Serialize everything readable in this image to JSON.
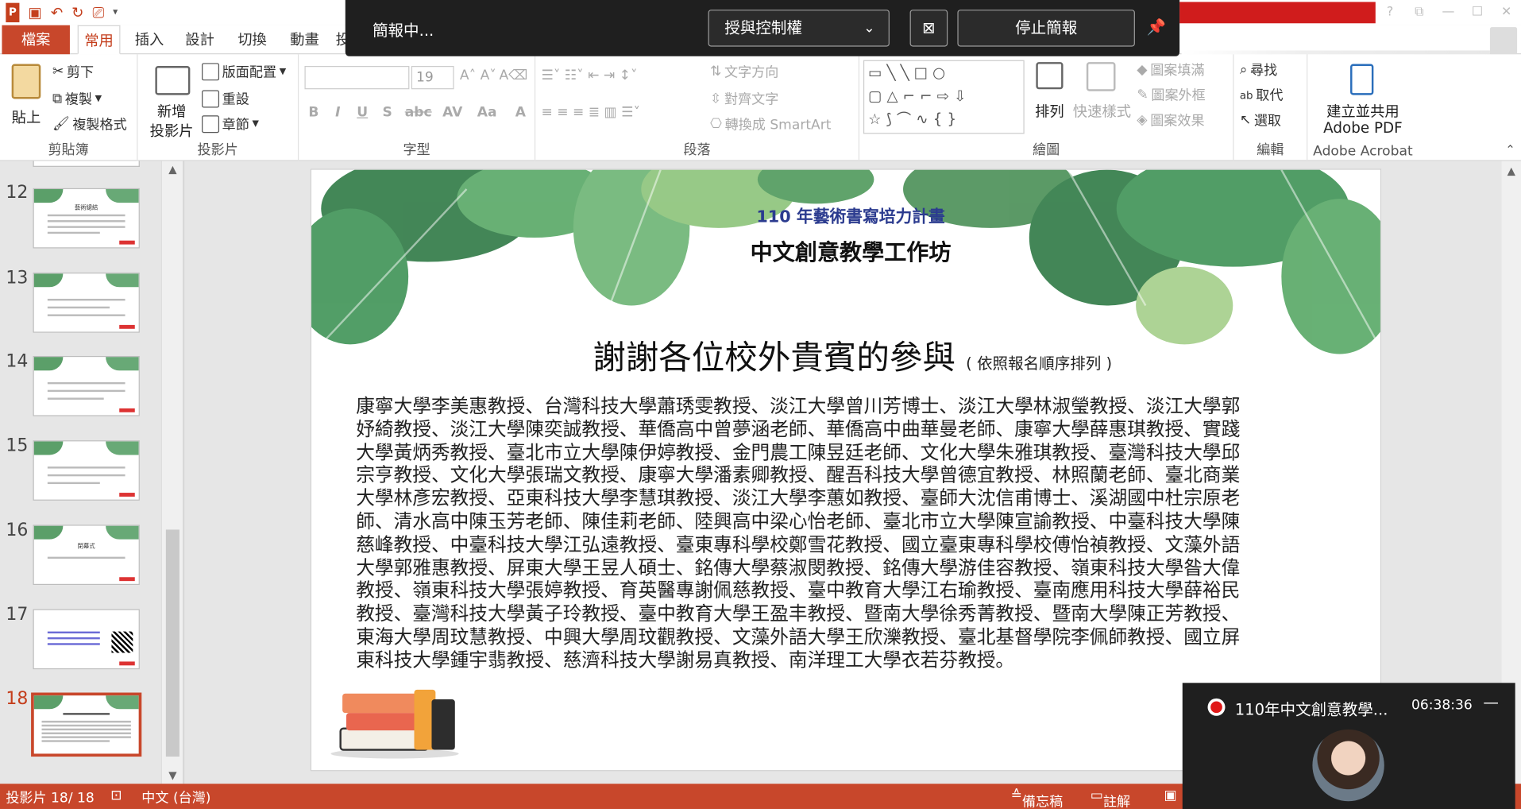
{
  "window": {
    "title_bar_buttons": [
      "?",
      "⧉",
      "—",
      "☐",
      "✕"
    ]
  },
  "tabs": [
    "檔案",
    "常用",
    "插入",
    "設計",
    "切換",
    "動畫",
    "投"
  ],
  "ribbon": {
    "clipboard": {
      "label": "剪貼簿",
      "paste": "貼上",
      "cut": "剪下",
      "copy": "複製",
      "format_painter": "複製格式"
    },
    "slides": {
      "label": "投影片",
      "new_slide_1": "新增",
      "new_slide_2": "投影片",
      "layout": "版面配置",
      "reset": "重設",
      "section": "章節"
    },
    "font": {
      "label": "字型",
      "size": "19"
    },
    "paragraph": {
      "label": "段落",
      "text_direction": "文字方向",
      "align_text": "對齊文字",
      "smartart": "轉換成 SmartArt"
    },
    "drawing": {
      "label": "繪圖",
      "arrange": "排列",
      "quick_styles": "快速樣式",
      "shape_fill": "圖案填滿",
      "shape_outline": "圖案外框",
      "shape_effects": "圖案效果"
    },
    "editing": {
      "label": "編輯",
      "find": "尋找",
      "replace": "取代",
      "select": "選取"
    },
    "acrobat": {
      "label": "Adobe Acrobat",
      "create_1": "建立並共用",
      "create_2": "Adobe PDF"
    }
  },
  "presenting": {
    "status": "簡報中...",
    "control": "授與控制權",
    "stop": "停止簡報"
  },
  "thumbnails": [
    {
      "num": "12",
      "caption": "藝術總結"
    },
    {
      "num": "13",
      "caption": ""
    },
    {
      "num": "14",
      "caption": ""
    },
    {
      "num": "15",
      "caption": ""
    },
    {
      "num": "16",
      "caption": "閉幕式"
    },
    {
      "num": "17",
      "caption": ""
    },
    {
      "num": "18",
      "caption": ""
    }
  ],
  "slide": {
    "subtitle": "110 年藝術書寫培力計畫",
    "heading": "中文創意教學工作坊",
    "title": "謝謝各位校外貴賓的參與",
    "title_note": "( 依照報名順序排列 )",
    "lines": [
      "康寧大學李美惠教授、台灣科技大學蕭琇雯教授、淡江大學曾川芳博士、淡江大學林淑瑩教授、淡江大學郭",
      "妤綺教授、淡江大學陳奕誠教授、華僑高中曾夢涵老師、華僑高中曲華曼老師、康寧大學薛惠琪教授、實踐",
      "大學黃炳秀教授、臺北市立大學陳伊婷教授、金門農工陳昱廷老師、文化大學朱雅琪教授、臺灣科技大學邱",
      "宗亨教授、文化大學張瑞文教授、康寧大學潘素卿教授、醒吾科技大學曾德宜教授、林照蘭老師、臺北商業",
      "大學林彥宏教授、亞東科技大學李慧琪教授、淡江大學李蕙如教授、臺師大沈信甫博士、溪湖國中杜宗原老",
      "師、清水高中陳玉芳老師、陳佳莉老師、陸興高中梁心怡老師、臺北市立大學陳宣諭教授、中臺科技大學陳",
      "慈峰教授、中臺科技大學江弘遠教授、臺東專科學校鄭雪花教授、國立臺東專科學校傅怡禎教授、文藻外語",
      "大學郭雅惠教授、屏東大學王昱人碩士、銘傳大學蔡淑閔教授、銘傳大學游佳容教授、嶺東科技大學昝大偉",
      "教授、嶺東科技大學張婷教授、育英醫專謝佩慈教授、臺中教育大學江右瑜教授、臺南應用科技大學薛裕民",
      "教授、臺灣科技大學黃子玲教授、臺中教育大學王盈丰教授、暨南大學徐秀菁教授、暨南大學陳正芳教授、",
      "東海大學周玟慧教授、中興大學周玟觀教授、文藻外語大學王欣濼教授、臺北基督學院李佩師教授、國立屏",
      "東科技大學鍾宇翡教授、慈濟科技大學謝易真教授、南洋理工大學衣若芬教授。"
    ]
  },
  "status": {
    "slide": "投影片 18/ 18",
    "lang": "中文 (台灣)",
    "notes": "備忘稿",
    "comments": "註解"
  },
  "video": {
    "name": "110年中文創意教學...",
    "time": "06:38:36",
    "min": "—"
  },
  "colors": {
    "accent": "#c8472b",
    "dark": "#1f1f1f",
    "navy": "#2b3b8f"
  }
}
